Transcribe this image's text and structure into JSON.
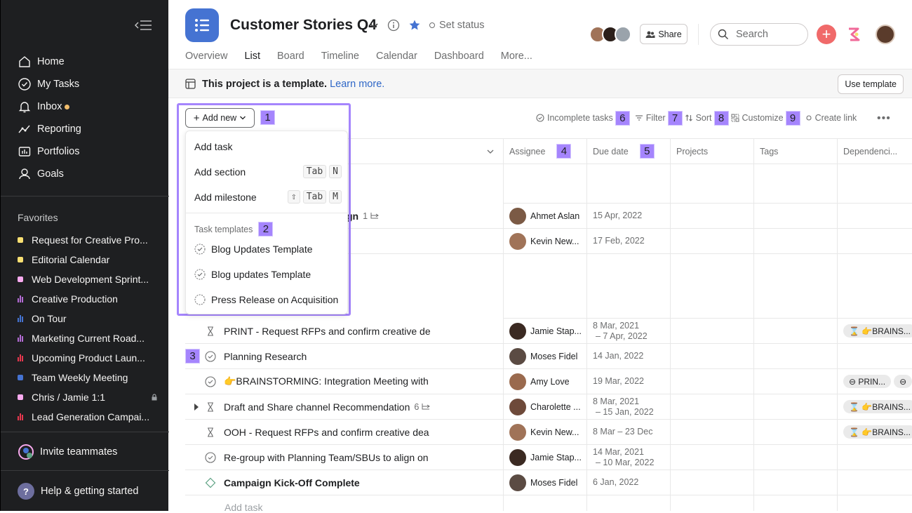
{
  "sidebar": {
    "nav": [
      {
        "label": "Home",
        "icon": "home-icon"
      },
      {
        "label": "My Tasks",
        "icon": "check-circle-icon"
      },
      {
        "label": "Inbox",
        "icon": "bell-icon"
      },
      {
        "label": "Reporting",
        "icon": "trend-icon"
      },
      {
        "label": "Portfolios",
        "icon": "portfolio-icon"
      },
      {
        "label": "Goals",
        "icon": "goals-icon"
      }
    ],
    "favorites_heading": "Favorites",
    "favorites": [
      {
        "label": "Request for Creative Pro...",
        "color": "#f8df72",
        "kind": "square"
      },
      {
        "label": "Editorial Calendar",
        "color": "#f8df72",
        "kind": "square"
      },
      {
        "label": "Web Development Sprint...",
        "color": "#f9aaef",
        "kind": "square"
      },
      {
        "label": "Creative Production",
        "color": "#b36bd4",
        "kind": "bars"
      },
      {
        "label": "On Tour",
        "color": "#4573d2",
        "kind": "bars"
      },
      {
        "label": "Marketing Current Road...",
        "color": "#b36bd4",
        "kind": "bars"
      },
      {
        "label": "Upcoming Product Laun...",
        "color": "#e8384f",
        "kind": "bars"
      },
      {
        "label": "Team Weekly Meeting",
        "color": "#4573d2",
        "kind": "square"
      },
      {
        "label": "Chris / Jamie 1:1",
        "color": "#f9aaef",
        "kind": "square"
      },
      {
        "label": "Lead Generation Campai...",
        "color": "#e8384f",
        "kind": "bars"
      }
    ],
    "invite": "Invite teammates",
    "help": "Help & getting started",
    "help_badge": "?"
  },
  "header": {
    "title": "Customer Stories Q4",
    "set_status": "Set status",
    "share": "Share",
    "search_placeholder": "Search",
    "tabs": [
      "Overview",
      "List",
      "Board",
      "Timeline",
      "Calendar",
      "Dashboard",
      "More..."
    ]
  },
  "banner": {
    "text": "This project is a template.",
    "link": "Learn more.",
    "use_template": "Use template"
  },
  "toolbar": {
    "add_new": "Add new",
    "incomplete": "Incomplete tasks",
    "filter": "Filter",
    "sort": "Sort",
    "customize": "Customize",
    "create_link": "Create link",
    "more": "•••",
    "markers": [
      "1",
      "2",
      "3",
      "4",
      "5",
      "6",
      "7",
      "8",
      "9"
    ]
  },
  "menu": {
    "add_task": "Add task",
    "add_section": "Add section",
    "add_section_keys": [
      "Tab",
      "N"
    ],
    "add_milestone": "Add milestone",
    "add_milestone_keys": [
      "⇧",
      "Tab",
      "M"
    ],
    "templates_heading": "Task templates",
    "templates": [
      "Blog Updates Template",
      "Blog updates Template",
      "Press Release on Acquisition"
    ]
  },
  "columns": [
    "Assignee",
    "Due date",
    "Projects",
    "Tags",
    "Dependenci..."
  ],
  "rows": [
    {
      "name": "gn",
      "subtasks": "1",
      "assignee": "Ahmet Aslan",
      "due": "15 Apr, 2022",
      "due2": "",
      "icon": "none",
      "bold": true,
      "av": "#7b5a45"
    },
    {
      "name": "",
      "subtasks": "",
      "assignee": "Kevin New...",
      "due": "17 Feb, 2022",
      "due2": "",
      "icon": "none",
      "bold": false,
      "av": "#a07358"
    },
    {
      "name": "PRINT - Request RFPs and confirm creative de",
      "subtasks": "",
      "assignee": "Jamie Stap...",
      "due": "8 Mar, 2021",
      "due2": "– 7 Apr, 2022",
      "icon": "hourglass",
      "bold": false,
      "av": "#3b2a22",
      "deps": [
        "⌛ 👉BRAINS..."
      ]
    },
    {
      "name": "Planning Research",
      "subtasks": "",
      "assignee": "Moses Fidel",
      "due": "14 Jan, 2022",
      "due2": "",
      "icon": "check",
      "bold": false,
      "av": "#5b4b43"
    },
    {
      "name": "👉BRAINSTORMING: Integration Meeting with",
      "subtasks": "",
      "assignee": "Amy Love",
      "due": "19 Mar, 2022",
      "due2": "",
      "icon": "check",
      "bold": false,
      "av": "#9a6a4e",
      "deps": [
        "⊖ PRIN...",
        "⊖"
      ]
    },
    {
      "name": "Draft and Share channel Recommendation",
      "subtasks": "6",
      "assignee": "Charolette ...",
      "due": "8 Mar, 2021",
      "due2": "– 15 Jan, 2022",
      "icon": "hourglass",
      "bold": false,
      "av": "#6e4a3a",
      "deps": [
        "⌛ 👉BRAINS..."
      ],
      "expand": true
    },
    {
      "name": "OOH - Request RFPs and confirm creative dea",
      "subtasks": "",
      "assignee": "Kevin New...",
      "due": "8 Mar – 23 Dec",
      "due2": "",
      "icon": "hourglass",
      "bold": false,
      "av": "#a07358",
      "deps": [
        "⌛ 👉BRAINS..."
      ]
    },
    {
      "name": "Re-group with Planning Team/SBUs to align on",
      "subtasks": "",
      "assignee": "Jamie Stap...",
      "due": "14 Mar, 2021",
      "due2": "– 10 Mar, 2022",
      "icon": "check",
      "bold": false,
      "av": "#3b2a22"
    },
    {
      "name": "Campaign Kick-Off Complete",
      "subtasks": "",
      "assignee": "Moses Fidel",
      "due": "6 Jan, 2022",
      "due2": "",
      "icon": "milestone",
      "bold": true,
      "av": "#5b4b43"
    }
  ],
  "add_task_row": "Add task"
}
